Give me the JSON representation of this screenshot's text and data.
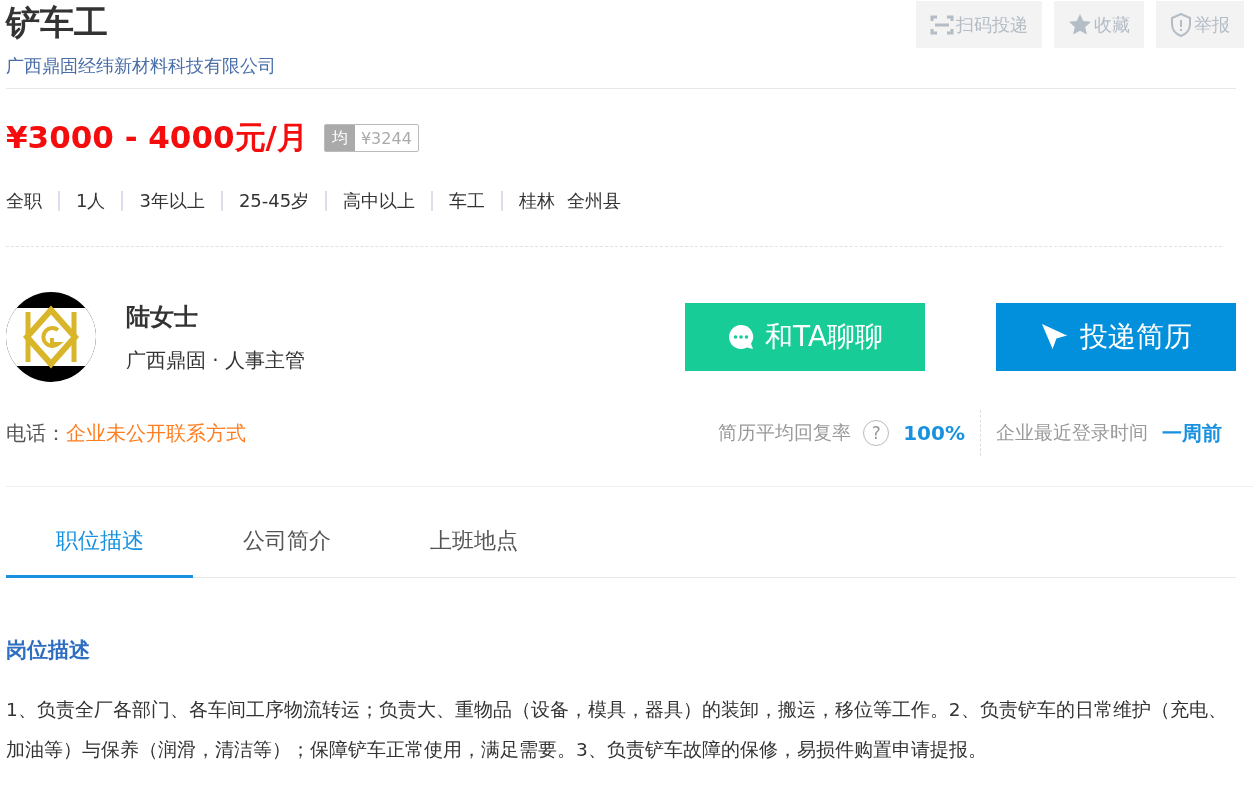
{
  "job": {
    "title": "铲车工",
    "company": "广西鼎固经纬新材料科技有限公司"
  },
  "actions": [
    {
      "kind": "scan",
      "label": "扫码投递"
    },
    {
      "kind": "star",
      "label": "收藏"
    },
    {
      "kind": "report",
      "label": "举报"
    }
  ],
  "salary": {
    "range": "¥3000 - 4000元/月",
    "avg_badge": "均",
    "avg_value": "¥3244"
  },
  "tags": [
    "全职",
    "1人",
    "3年以上",
    "25-45岁",
    "高中以上",
    "车工",
    "桂林  全州县"
  ],
  "contact": {
    "name": "陆女士",
    "role": "广西鼎固 · 人事主管",
    "phone_label": "电话：",
    "phone_value": "企业未公开联系方式"
  },
  "buttons": [
    {
      "kind": "chat",
      "label": "和TA聊聊"
    },
    {
      "kind": "apply",
      "label": "投递简历"
    }
  ],
  "stats": [
    {
      "label": "简历平均回复率",
      "help": "?",
      "value": "100%"
    },
    {
      "label": "企业最近登录时间",
      "value": "一周前"
    }
  ],
  "tabs": [
    {
      "label": "职位描述",
      "selected": true
    },
    {
      "label": "公司简介",
      "selected": false
    },
    {
      "label": "上班地点",
      "selected": false
    }
  ],
  "section": {
    "heading": "岗位描述",
    "text": "1、负责全厂各部门、各车间工序物流转运；负责大、重物品（设备，模具，器具）的装卸，搬运，移位等工作。2、负责铲车的日常维护（充电、加油等）与保养（润滑，清洁等）；保障铲车正常使用，满足需要。3、负责铲车故障的保修，易损件购置申请提报。"
  }
}
